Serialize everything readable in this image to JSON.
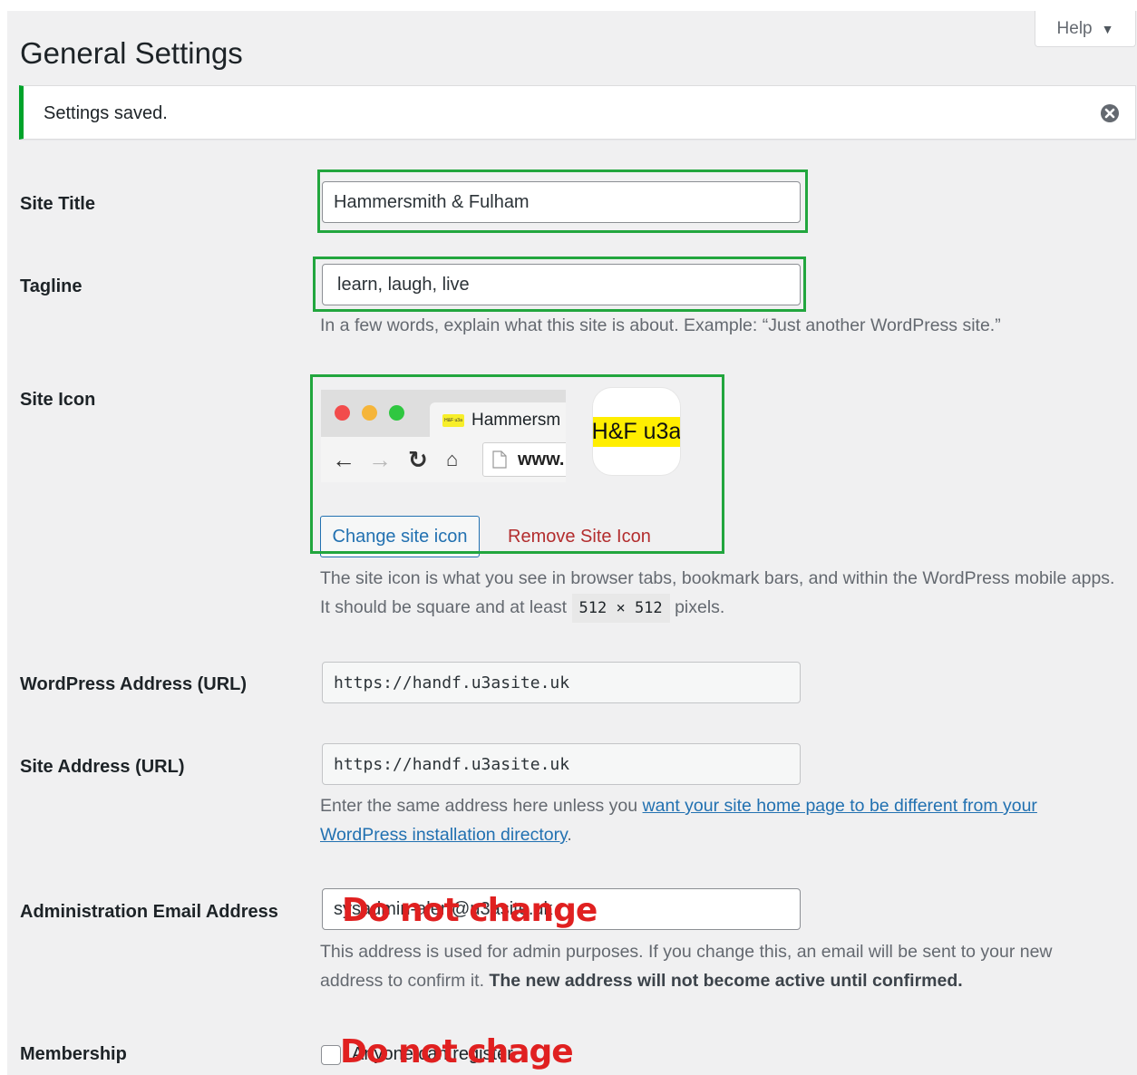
{
  "help": {
    "label": "Help",
    "arrow": "▼"
  },
  "page": {
    "title": "General Settings"
  },
  "notice": {
    "message": "Settings saved.",
    "dismiss_icon": "dismiss-circle-icon"
  },
  "site_title": {
    "label": "Site Title",
    "value": "Hammersmith & Fulham"
  },
  "tagline": {
    "label": "Tagline",
    "value": "learn, laugh, live",
    "description": "In a few words, explain what this site is about. Example: “Just another WordPress site.”"
  },
  "site_icon": {
    "label": "Site Icon",
    "preview_tab_title": "Hammersm",
    "preview_url": "www.",
    "favicon_text": "H&F u3a",
    "icon_text": "H&F u3a",
    "change_button": "Change site icon",
    "remove_link": "Remove Site Icon",
    "description_before": "The site icon is what you see in browser tabs, bookmark bars, and within the WordPress mobile apps. It should be square and at least",
    "size_code": "512 × 512",
    "description_after": "pixels."
  },
  "wp_address": {
    "label": "WordPress Address (URL)",
    "value": "https://handf.u3asite.uk"
  },
  "site_address": {
    "label": "Site Address (URL)",
    "value": "https://handf.u3asite.uk",
    "description_before": "Enter the same address here unless you",
    "description_link": "want your site home page to be different from your WordPress installation directory",
    "description_after": "."
  },
  "admin_email": {
    "label": "Administration Email Address",
    "value": "sysadmin-alert@u3asite.uk",
    "overlay": "Do not change",
    "description": "This address is used for admin purposes. If you change this, an email will be sent to your new address to confirm it.",
    "description_bold": "The new address will not become active until confirmed."
  },
  "membership": {
    "label": "Membership",
    "checkbox_label": "Anyone can register",
    "overlay": "Do not chage"
  },
  "colors": {
    "highlight": "#22a63e",
    "notice_border": "#00a32a",
    "link": "#2271b1",
    "danger": "#b32d2e",
    "overlay": "#e02020"
  }
}
